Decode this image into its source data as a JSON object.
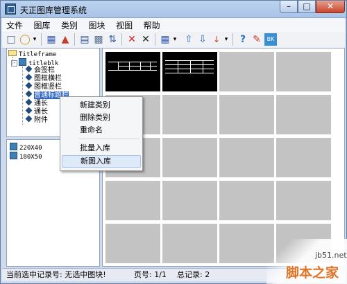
{
  "window": {
    "title": "天正图库管理系统",
    "controls": {
      "minimize": "–",
      "maximize": "□",
      "close": "✕"
    }
  },
  "menu": [
    "文件",
    "图库",
    "类别",
    "图块",
    "视图",
    "帮助"
  ],
  "toolbar": {
    "icons": [
      "new-library-icon",
      "open-library-icon",
      "dropdown-icon",
      "layout-icon",
      "warning-icon",
      "export-icon",
      "print-icon",
      "replace-icon",
      "delete-icon",
      "cut-icon",
      "view-mode-icon",
      "dropdown-icon",
      "move-up-icon",
      "move-down-icon",
      "sort-icon",
      "dropdown-icon",
      "help-icon",
      "edit-icon",
      "block-icon"
    ]
  },
  "tree": {
    "root": "Titleframe",
    "group": "titleblk",
    "children": [
      "会签栏",
      "图框横栏",
      "图框竖栏",
      "普通标题栏",
      "通长",
      "通长",
      "附件"
    ]
  },
  "blocks": [
    "220X40",
    "180X50"
  ],
  "context_menu": {
    "items": [
      "新建类别",
      "删除类别",
      "重命名",
      "批量入库",
      "新图入库"
    ],
    "hover_item": "新图入库"
  },
  "status": {
    "record": "当前选中记录号: 无选中图块!",
    "page": "页号: 1/1",
    "total": "总记录:  2"
  },
  "watermark": {
    "url": "jb51.net",
    "brand": "脚本之家"
  },
  "colors": {
    "titlebar": "#a9c4e6",
    "selection": "#3168c4",
    "close_button": "#c6452b",
    "cell_empty": "#c3c3c3",
    "cell_filled": "#000000",
    "watermark_brand": "#e27221"
  }
}
